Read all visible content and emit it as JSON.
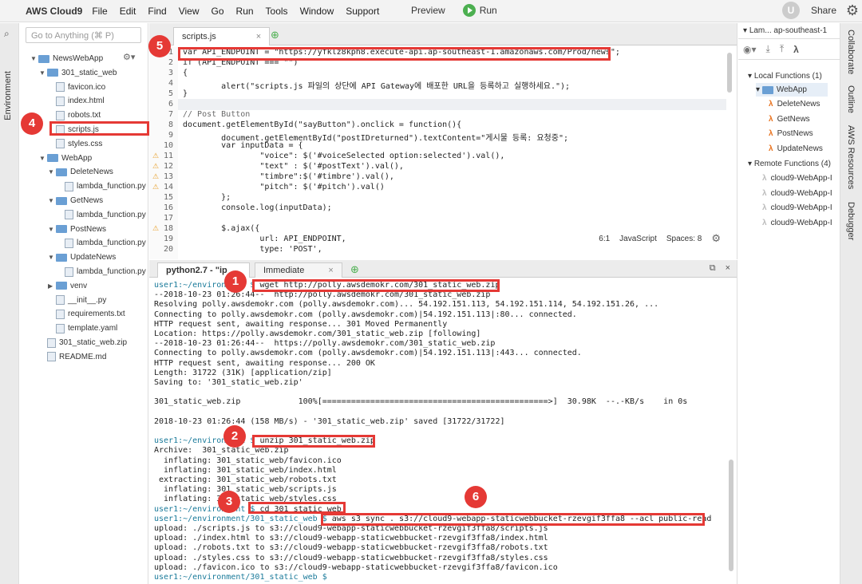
{
  "menubar": {
    "brand": "AWS Cloud9",
    "menus": [
      "File",
      "Edit",
      "Find",
      "View",
      "Go",
      "Run",
      "Tools",
      "Window",
      "Support"
    ],
    "preview": "Preview",
    "run": "Run",
    "avatar": "U",
    "share": "Share"
  },
  "sidebar": {
    "label": "Environment",
    "goto_placeholder": "Go to Anything (⌘ P)"
  },
  "tree": [
    {
      "label": "NewsWebApp",
      "type": "folder",
      "depth": 0,
      "open": true
    },
    {
      "label": "301_static_web",
      "type": "folder",
      "depth": 1,
      "open": true
    },
    {
      "label": "favicon.ico",
      "type": "file",
      "depth": 2
    },
    {
      "label": "index.html",
      "type": "file",
      "depth": 2
    },
    {
      "label": "robots.txt",
      "type": "file",
      "depth": 2
    },
    {
      "label": "scripts.js",
      "type": "file",
      "depth": 2
    },
    {
      "label": "styles.css",
      "type": "file",
      "depth": 2
    },
    {
      "label": "WebApp",
      "type": "folder",
      "depth": 1,
      "open": true
    },
    {
      "label": "DeleteNews",
      "type": "folder",
      "depth": 2,
      "open": true
    },
    {
      "label": "lambda_function.py",
      "type": "file",
      "depth": 3
    },
    {
      "label": "GetNews",
      "type": "folder",
      "depth": 2,
      "open": true
    },
    {
      "label": "lambda_function.py",
      "type": "file",
      "depth": 3
    },
    {
      "label": "PostNews",
      "type": "folder",
      "depth": 2,
      "open": true
    },
    {
      "label": "lambda_function.py",
      "type": "file",
      "depth": 3
    },
    {
      "label": "UpdateNews",
      "type": "folder",
      "depth": 2,
      "open": true
    },
    {
      "label": "lambda_function.py",
      "type": "file",
      "depth": 3
    },
    {
      "label": "venv",
      "type": "folder",
      "depth": 2,
      "open": false
    },
    {
      "label": "__init__.py",
      "type": "file",
      "depth": 2
    },
    {
      "label": "requirements.txt",
      "type": "file",
      "depth": 2
    },
    {
      "label": "template.yaml",
      "type": "file",
      "depth": 2
    },
    {
      "label": "301_static_web.zip",
      "type": "file",
      "depth": 1
    },
    {
      "label": "README.md",
      "type": "file",
      "depth": 1
    }
  ],
  "editor": {
    "tab": "scripts.js",
    "status_pos": "6:1",
    "status_lang": "JavaScript",
    "status_spaces": "Spaces: 8",
    "lines": [
      "var API_ENDPOINT = \"https://yfklz8kph8.execute-api.ap-southeast-1.amazonaws.com/Prod/news\";",
      "if (API_ENDPOINT === \"\")",
      "{",
      "        alert(\"scripts.js 파일의 상단에 API Gateway에 배포한 URL을 등록하고 실행하세요.\");",
      "}",
      "",
      "// Post Button",
      "document.getElementById(\"sayButton\").onclick = function(){",
      "        document.getElementById(\"postIDreturned\").textContent=\"게시물 등록: 요청중\";",
      "        var inputData = {",
      "                \"voice\": $('#voiceSelected option:selected').val(),",
      "                \"text\" : $('#postText').val(),",
      "                \"timbre\":$('#timbre').val(),",
      "                \"pitch\": $('#pitch').val()",
      "        };",
      "        console.log(inputData);",
      "",
      "        $.ajax({",
      "                url: API_ENDPOINT,",
      "                type: 'POST',"
    ],
    "line_numbers": [
      "1",
      "2",
      "3",
      "4",
      "5",
      "6",
      "7",
      "8",
      "9",
      "10",
      "11",
      "12",
      "13",
      "14",
      "15",
      "16",
      "17",
      "18",
      "19",
      "20"
    ],
    "warn_lines": [
      11,
      12,
      13,
      14,
      18
    ]
  },
  "terminal": {
    "tab1": "python2.7 - \"ip",
    "tab2": "Immediate",
    "lines": [
      {
        "p": "user1:~/environment $ ",
        "t": "wget http://polly.awsdemokr.com/301_static_web.zip"
      },
      {
        "p": "",
        "t": "--2018-10-23 01:26:44--  http://polly.awsdemokr.com/301_static_web.zip"
      },
      {
        "p": "",
        "t": "Resolving polly.awsdemokr.com (polly.awsdemokr.com)... 54.192.151.113, 54.192.151.114, 54.192.151.26, ..."
      },
      {
        "p": "",
        "t": "Connecting to polly.awsdemokr.com (polly.awsdemokr.com)|54.192.151.113|:80... connected."
      },
      {
        "p": "",
        "t": "HTTP request sent, awaiting response... 301 Moved Permanently"
      },
      {
        "p": "",
        "t": "Location: https://polly.awsdemokr.com/301_static_web.zip [following]"
      },
      {
        "p": "",
        "t": "--2018-10-23 01:26:44--  https://polly.awsdemokr.com/301_static_web.zip"
      },
      {
        "p": "",
        "t": "Connecting to polly.awsdemokr.com (polly.awsdemokr.com)|54.192.151.113|:443... connected."
      },
      {
        "p": "",
        "t": "HTTP request sent, awaiting response... 200 OK"
      },
      {
        "p": "",
        "t": "Length: 31722 (31K) [application/zip]"
      },
      {
        "p": "",
        "t": "Saving to: '301_static_web.zip'"
      },
      {
        "p": "",
        "t": ""
      },
      {
        "p": "",
        "t": "301_static_web.zip            100%[===============================================>]  30.98K  --.-KB/s    in 0s"
      },
      {
        "p": "",
        "t": ""
      },
      {
        "p": "",
        "t": "2018-10-23 01:26:44 (158 MB/s) - '301_static_web.zip' saved [31722/31722]"
      },
      {
        "p": "",
        "t": ""
      },
      {
        "p": "user1:~/environment $ ",
        "t": "unzip 301_static_web.zip"
      },
      {
        "p": "",
        "t": "Archive:  301_static_web.zip"
      },
      {
        "p": "",
        "t": "  inflating: 301_static_web/favicon.ico"
      },
      {
        "p": "",
        "t": "  inflating: 301_static_web/index.html"
      },
      {
        "p": "",
        "t": " extracting: 301_static_web/robots.txt"
      },
      {
        "p": "",
        "t": "  inflating: 301_static_web/scripts.js"
      },
      {
        "p": "",
        "t": "  inflating: 301_static_web/styles.css"
      },
      {
        "p": "user1:~/environment $ ",
        "t": "cd 301_static_web"
      },
      {
        "p": "user1:~/environment/301_static_web $ ",
        "t": "aws s3 sync . s3://cloud9-webapp-staticwebbucket-rzevgif3ffa8 --acl public-read"
      },
      {
        "p": "",
        "t": "upload: ./scripts.js to s3://cloud9-webapp-staticwebbucket-rzevgif3ffa8/scripts.js"
      },
      {
        "p": "",
        "t": "upload: ./index.html to s3://cloud9-webapp-staticwebbucket-rzevgif3ffa8/index.html"
      },
      {
        "p": "",
        "t": "upload: ./robots.txt to s3://cloud9-webapp-staticwebbucket-rzevgif3ffa8/robots.txt"
      },
      {
        "p": "",
        "t": "upload: ./styles.css to s3://cloud9-webapp-staticwebbucket-rzevgif3ffa8/styles.css"
      },
      {
        "p": "",
        "t": "upload: ./favicon.ico to s3://cloud9-webapp-staticwebbucket-rzevgif3ffa8/favicon.ico"
      },
      {
        "p": "user1:~/environment/301_static_web $ ",
        "t": ""
      }
    ]
  },
  "aws": {
    "header": "Lam...  ap-southeast-1",
    "local": "Local Functions (1)",
    "app": "WebApp",
    "funcs": [
      "DeleteNews",
      "GetNews",
      "PostNews",
      "UpdateNews"
    ],
    "remote": "Remote Functions (4)",
    "remote_funcs": [
      "cloud9-WebApp-I",
      "cloud9-WebApp-I",
      "cloud9-WebApp-I",
      "cloud9-WebApp-I"
    ]
  },
  "righttabs": [
    "Collaborate",
    "Outline",
    "AWS Resources",
    "Debugger"
  ],
  "badges": [
    "1",
    "2",
    "3",
    "4",
    "5",
    "6"
  ]
}
